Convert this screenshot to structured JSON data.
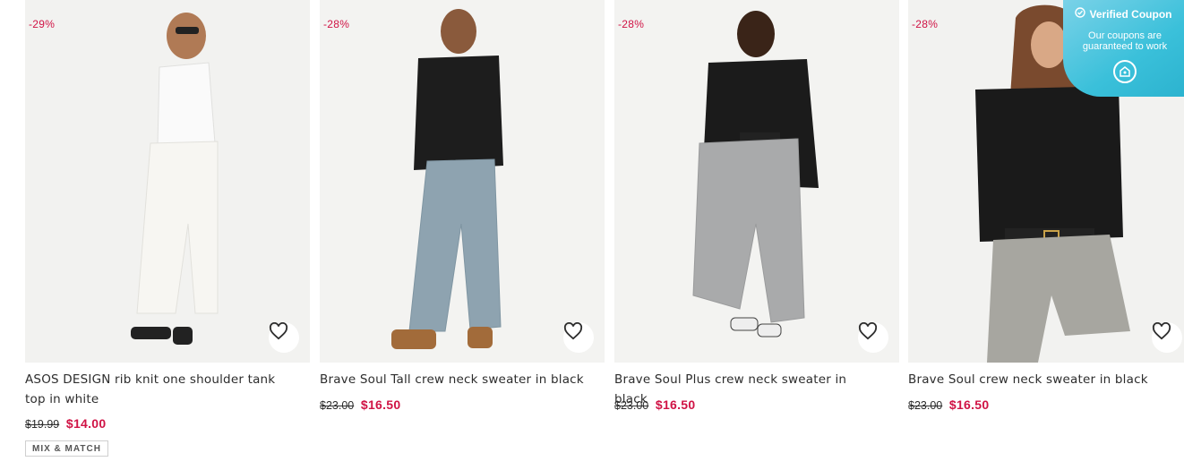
{
  "products": [
    {
      "discount": "-29%",
      "title": "ASOS DESIGN rib knit one shoulder tank top in white",
      "old_price": "$19.99",
      "sale_price": "$14.00",
      "badge": "MIX & MATCH"
    },
    {
      "discount": "-28%",
      "title": "Brave Soul Tall crew neck sweater in black",
      "old_price": "$23.00",
      "sale_price": "$16.50"
    },
    {
      "discount": "-28%",
      "title": "Brave Soul Plus crew neck sweater in black",
      "old_price": "$23.00",
      "sale_price": "$16.50"
    },
    {
      "discount": "-28%",
      "title": "Brave Soul crew neck sweater in black",
      "old_price": "$23.00",
      "sale_price": "$16.50"
    }
  ],
  "coupon_widget": {
    "title": "Verified Coupon",
    "subtitle": "Our coupons are guaranteed to work",
    "icons": [
      "check-circle-icon",
      "coupon-logo-icon"
    ]
  },
  "icons": {
    "wishlist": "heart-outline-icon"
  },
  "colors": {
    "sale": "#d01345",
    "coupon_bg": "#3ac0da"
  }
}
